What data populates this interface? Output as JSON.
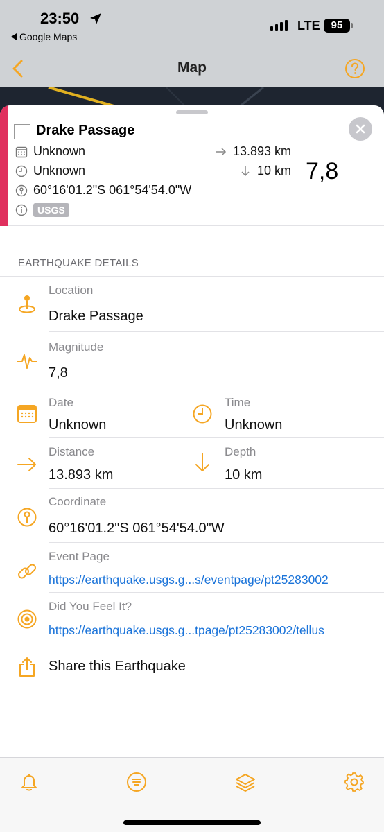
{
  "status_bar": {
    "time": "23:50",
    "back_app": "Google Maps",
    "network": "LTE",
    "battery": "95"
  },
  "nav": {
    "title": "Map"
  },
  "summary": {
    "title": "Drake Passage",
    "date": "Unknown",
    "time": "Unknown",
    "coordinate": "60°16'01.2\"S 061°54'54.0\"W",
    "source_badge": "USGS",
    "distance": "13.893 km",
    "depth": "10 km",
    "magnitude": "7,8"
  },
  "details": {
    "section_title": "EARTHQUAKE DETAILS",
    "location_label": "Location",
    "location_value": "Drake Passage",
    "magnitude_label": "Magnitude",
    "magnitude_value": "7,8",
    "date_label": "Date",
    "date_value": "Unknown",
    "time_label": "Time",
    "time_value": "Unknown",
    "distance_label": "Distance",
    "distance_value": "13.893 km",
    "depth_label": "Depth",
    "depth_value": "10 km",
    "coordinate_label": "Coordinate",
    "coordinate_value": "60°16'01.2\"S 061°54'54.0\"W",
    "event_page_label": "Event Page",
    "event_page_link": "https://earthquake.usgs.g...s/eventpage/pt25283002",
    "felt_label": "Did You Feel It?",
    "felt_link": "https://earthquake.usgs.g...tpage/pt25283002/tellus",
    "share_label": "Share this Earthquake"
  },
  "colors": {
    "accent": "#f5a623",
    "red_bar": "#e0305e",
    "link": "#1a73d9"
  },
  "tabs": [
    "bell-icon",
    "list-icon",
    "layers-icon",
    "gear-icon"
  ]
}
